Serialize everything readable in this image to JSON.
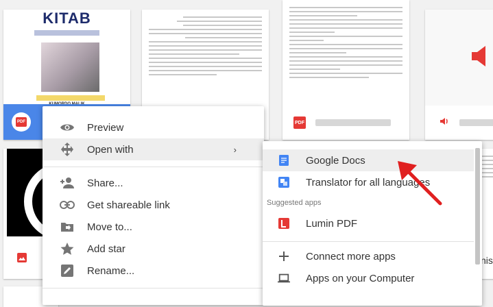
{
  "colors": {
    "accent_blue": "#4a86e8",
    "pdf_red": "#e53935",
    "docs_blue": "#4285f4",
    "arrow_red": "#e02020"
  },
  "files": {
    "kitab_cover_title": "KITAB",
    "kitab_author": "KUMORDO MALIK",
    "pdf_badge": "PDF"
  },
  "menu": {
    "items": [
      {
        "label": "Preview",
        "icon": "eye-icon"
      },
      {
        "label": "Open with",
        "icon": "move-arrows-icon"
      },
      {
        "label": "Share...",
        "icon": "add-person-icon"
      },
      {
        "label": "Get shareable link",
        "icon": "link-icon"
      },
      {
        "label": "Move to...",
        "icon": "folder-move-icon"
      },
      {
        "label": "Add star",
        "icon": "star-icon"
      },
      {
        "label": "Rename...",
        "icon": "pencil-icon"
      }
    ],
    "chevron": "›"
  },
  "submenu": {
    "items": [
      {
        "label": "Google Docs",
        "icon": "google-docs-icon"
      },
      {
        "label": "Translator for all languages",
        "icon": "translator-icon"
      }
    ],
    "suggested_header": "Suggested apps",
    "suggested": [
      {
        "label": "Lumin PDF",
        "icon": "lumin-pdf-icon"
      }
    ],
    "bottom": [
      {
        "label": "Connect more apps",
        "icon": "plus-icon"
      },
      {
        "label": "Apps on your Computer",
        "icon": "laptop-icon"
      }
    ]
  },
  "partial_right_text": "nis"
}
